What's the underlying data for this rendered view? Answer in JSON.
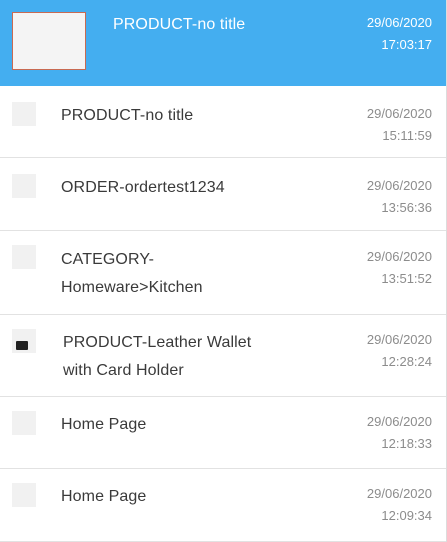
{
  "items": [
    {
      "title": "PRODUCT-no title",
      "date": "29/06/2020",
      "time": "17:03:17",
      "thumb": "placeholder-image"
    },
    {
      "title": "PRODUCT-no title",
      "date": "29/06/2020",
      "time": "15:11:59",
      "thumb": "placeholder-image"
    },
    {
      "title": "ORDER-ordertest1234",
      "date": "29/06/2020",
      "time": "13:56:36",
      "thumb": "placeholder-image"
    },
    {
      "title": "CATEGORY-Homeware>Kitchen",
      "date": "29/06/2020",
      "time": "13:51:52",
      "thumb": "placeholder-image"
    },
    {
      "title": "PRODUCT-Leather Wallet with Card Holder",
      "date": "29/06/2020",
      "time": "12:28:24",
      "thumb": "wallet-image"
    },
    {
      "title": "Home Page",
      "date": "29/06/2020",
      "time": "12:18:33",
      "thumb": "placeholder-image"
    },
    {
      "title": "Home Page",
      "date": "29/06/2020",
      "time": "12:09:34",
      "thumb": "placeholder-image"
    }
  ],
  "colors": {
    "selected_background": "#44aef0",
    "title_text": "#3a3a3a",
    "timestamp_text": "#8c8c8c",
    "divider": "#e2e2e2"
  }
}
